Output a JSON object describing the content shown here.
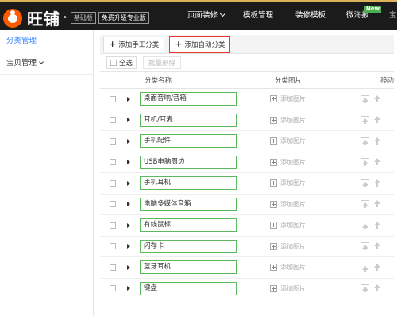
{
  "header": {
    "logo_text": "旺铺",
    "edition_badge": "基础版",
    "upgrade_badge": "免费升级专业版",
    "nav": [
      {
        "label": "页面装修"
      },
      {
        "label": "模板管理"
      },
      {
        "label": "装修模板"
      },
      {
        "label": "微海报",
        "tag": "New"
      },
      {
        "label": "宝贝"
      }
    ]
  },
  "sidebar": {
    "items": [
      {
        "label": "分类管理"
      },
      {
        "label": "宝贝管理"
      }
    ]
  },
  "toolbar": {
    "add_manual_label": "添加手工分类",
    "add_auto_label": "添加自动分类",
    "select_all_label": "全选",
    "batch_delete_label": "批量删除"
  },
  "table": {
    "columns": {
      "name": "分类名称",
      "image": "分类图片",
      "move": "移动"
    },
    "add_image_label": "添加图片",
    "rows": [
      {
        "name": "桌面音响/音箱"
      },
      {
        "name": "耳机/耳麦"
      },
      {
        "name": "手机配件"
      },
      {
        "name": "USB电脑周边"
      },
      {
        "name": "手机耳机"
      },
      {
        "name": "电脑多媒体音箱"
      },
      {
        "name": "有线鼠标"
      },
      {
        "name": "闪存卡"
      },
      {
        "name": "蓝牙耳机"
      },
      {
        "name": "键盘"
      }
    ]
  },
  "colors": {
    "topbar_bg": "#1b1b1b",
    "logo_orange": "#ff5a00",
    "active_blue": "#3a86ff",
    "highlight_red": "#e53935",
    "input_green": "#5cb85c",
    "new_tag_green": "#4caf50"
  }
}
